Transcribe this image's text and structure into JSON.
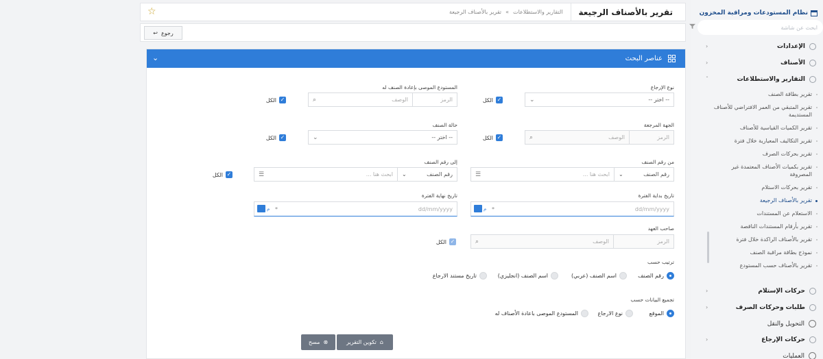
{
  "sidebar": {
    "app_title": "نظام المستودعات ومراقبة المخزون",
    "search_placeholder": "ابحث عن شاشة",
    "menu": [
      {
        "label": "الإعدادات"
      },
      {
        "label": "الأصناف"
      },
      {
        "label": "التقارير والاستطلاعات"
      }
    ],
    "reports": [
      "تقرير بطاقة الصنف",
      "تقرير المتبقي من العمر الافتراضي للأصناف المستديمة",
      "تقرير الكميات القياسية للأصناف",
      "تقرير التكاليف المعيارية خلال فترة",
      "تقرير بحركات الصرف",
      "تقرير بكميات الأصناف المعتمدة غير المصروفة",
      "تقرير بحركات الاستلام",
      "تقرير بالأصناف الرجيعة",
      "الاستعلام عن المستندات",
      "تقرير بأرقام المستندات الناقصة",
      "تقرير بالأصناف الراكدة خلال فترة",
      "نموذج بطاقة مراقبة الصنف",
      "تقرير بالأصناف حسب المستودع"
    ],
    "lower_menu": [
      {
        "label": "حركات الإستلام"
      },
      {
        "label": "طلبات وحركات الصرف"
      }
    ],
    "transfer": "التحويل والنقل",
    "returns": "حركات الإرجاع",
    "operations": "العمليات"
  },
  "header": {
    "title": "تقرير بالأصناف الرجيعة",
    "breadcrumb": [
      "التقارير والاستطلاعات",
      "»",
      "تقرير بالأصناف الرجيعة"
    ]
  },
  "toolbar": {
    "back_label": "رجوع"
  },
  "panel": {
    "title": "عناصر البحث",
    "return_type": {
      "label": "نوع الإرجاع",
      "placeholder": "-- اختر --",
      "all": "الكل"
    },
    "warehouse": {
      "label": "المستودع الموصى بإعادة الصنف له",
      "code": "الرمز",
      "desc": "الوصف",
      "all": "الكل"
    },
    "party": {
      "label": "الجهة المرجعة",
      "code": "الرمز",
      "desc": "الوصف",
      "all": "الكل"
    },
    "status": {
      "label": "حالة الصنف",
      "placeholder": "-- اختر --",
      "all": "الكل"
    },
    "from_item": {
      "label": "من رقم الصنف",
      "select": "رقم الصنف",
      "search": "ابحث هنا ..."
    },
    "to_item": {
      "label": "إلى رقم الصنف",
      "select": "رقم الصنف",
      "search": "ابحث هنا ...",
      "all": "الكل"
    },
    "start_date": {
      "label": "تاريخ بداية الفترة",
      "placeholder": "dd/mm/yyyy",
      "suffix": "م",
      "req": "*"
    },
    "end_date": {
      "label": "تاريخ نهاية الفترة",
      "placeholder": "dd/mm/yyyy",
      "suffix": "م",
      "req": "*"
    },
    "custodian": {
      "label": "صاحب العهد",
      "code": "الرمز",
      "desc": "الوصف",
      "all": "الكل"
    },
    "sort": {
      "label": "ترتيب حسب",
      "options": [
        "رقم الصنف",
        "اسم الصنف (عربي)",
        "اسم الصنف (انجليزي)",
        "تاريخ مستند الارجاع"
      ],
      "selected": 0
    },
    "group": {
      "label": "تجميع البيانات حسب",
      "options": [
        "الموقع",
        "نوع الارجاع",
        "المستودع الموصى باعادة الأصناف له"
      ],
      "selected": 0
    },
    "generate_label": "تكوين التقرير",
    "clear_label": "مسح"
  },
  "colors": {
    "primary": "#2f7dd9",
    "button": "#6d7683"
  }
}
